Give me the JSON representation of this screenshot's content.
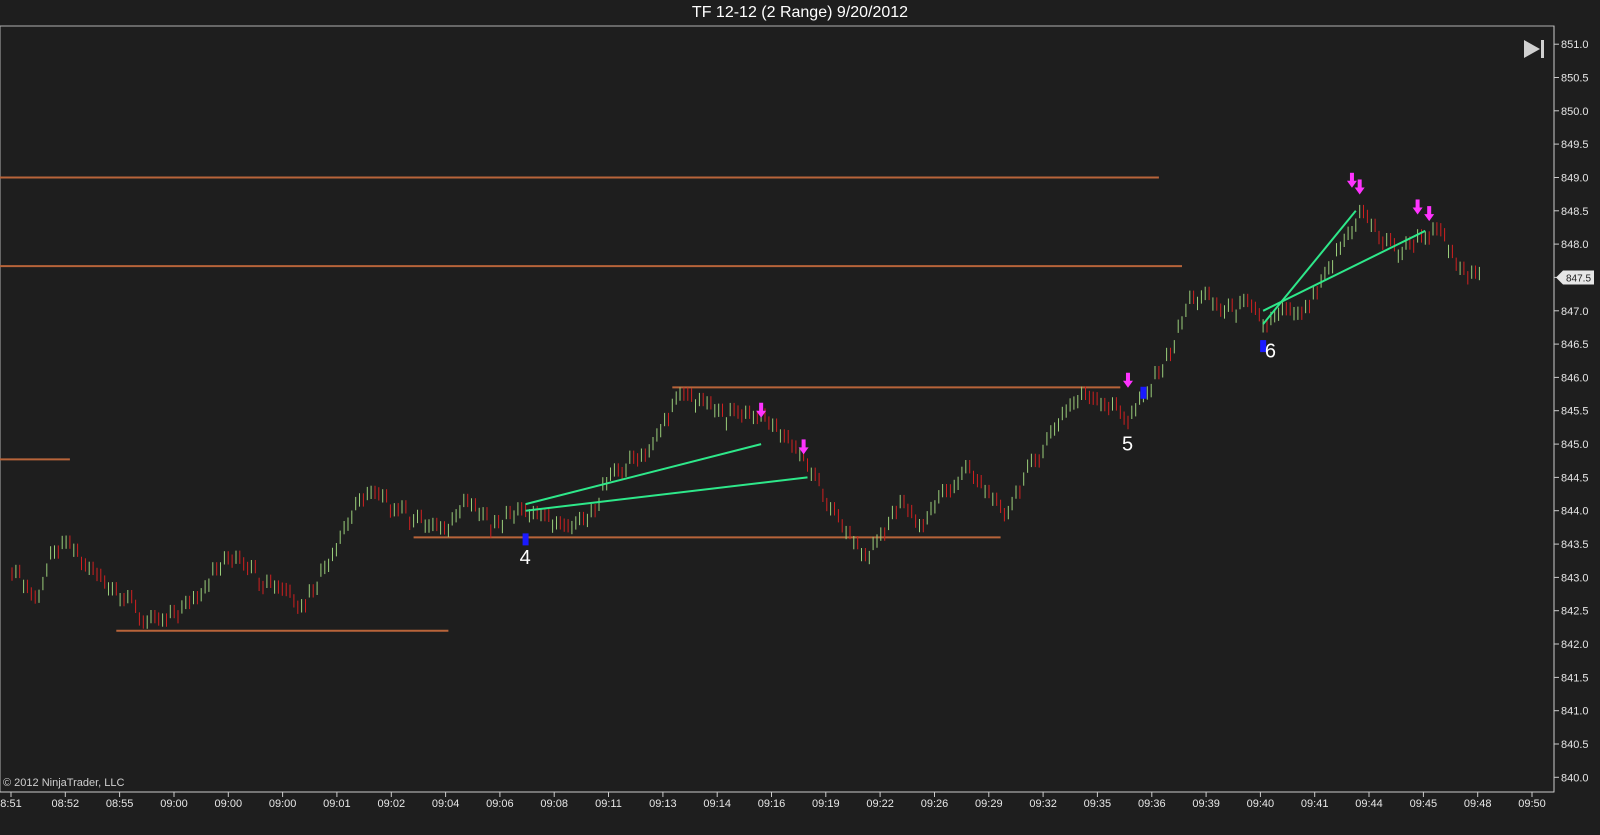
{
  "window": {
    "title": "TF 12-12 (2 Range)  9/20/2012"
  },
  "copyright": "© 2012 NinjaTrader, LLC",
  "current_price_tag": "847.5",
  "colors": {
    "background": "#1e1e1e",
    "up_bar": "#9acd7a",
    "down_bar": "#d02020",
    "level_line": "#b8643a",
    "trend_line": "#2ee88a",
    "sell_signal": "#ff33ff",
    "buy_signal": "#1a1aff",
    "axis": "#cccccc"
  },
  "icons": {
    "scroll_end": "skip-to-end-icon"
  },
  "chart_data": {
    "type": "bar",
    "title": "TF 12-12 (2 Range)  9/20/2012",
    "instrument": "TF 12-12",
    "bar_type": "2 Range",
    "date": "9/20/2012",
    "x_tick_labels": [
      "8:51",
      "08:52",
      "08:55",
      "09:00",
      "09:00",
      "09:00",
      "09:01",
      "09:02",
      "09:04",
      "09:06",
      "09:08",
      "09:11",
      "09:13",
      "09:14",
      "09:16",
      "09:19",
      "09:22",
      "09:26",
      "09:29",
      "09:32",
      "09:35",
      "09:36",
      "09:39",
      "09:40",
      "09:41",
      "09:44",
      "09:45",
      "09:48",
      "09:50"
    ],
    "y_tick_labels": [
      "851.0",
      "850.5",
      "850.0",
      "849.5",
      "849.0",
      "848.5",
      "848.0",
      "847.5",
      "847.0",
      "846.5",
      "846.0",
      "845.5",
      "845.0",
      "844.5",
      "844.0",
      "843.5",
      "843.0",
      "842.5",
      "842.0",
      "841.5",
      "841.0",
      "840.5",
      "840.0"
    ],
    "ylim": [
      839.9,
      851.1
    ],
    "bar_count": 285,
    "bars": [
      {
        "bar": 0,
        "price": 843.1
      },
      {
        "bar": 6,
        "price": 842.7
      },
      {
        "bar": 10,
        "price": 843.3
      },
      {
        "bar": 14,
        "price": 843.5
      },
      {
        "bar": 18,
        "price": 843.2
      },
      {
        "bar": 23,
        "price": 843.0
      },
      {
        "bar": 28,
        "price": 842.8
      },
      {
        "bar": 33,
        "price": 842.4
      },
      {
        "bar": 38,
        "price": 842.3
      },
      {
        "bar": 45,
        "price": 842.6
      },
      {
        "bar": 52,
        "price": 843.1
      },
      {
        "bar": 58,
        "price": 843.4
      },
      {
        "bar": 64,
        "price": 843.0
      },
      {
        "bar": 70,
        "price": 842.9
      },
      {
        "bar": 75,
        "price": 842.6
      },
      {
        "bar": 80,
        "price": 843.1
      },
      {
        "bar": 86,
        "price": 843.8
      },
      {
        "bar": 92,
        "price": 844.3
      },
      {
        "bar": 98,
        "price": 844.1
      },
      {
        "bar": 104,
        "price": 843.9
      },
      {
        "bar": 110,
        "price": 843.7
      },
      {
        "bar": 117,
        "price": 844.1
      },
      {
        "bar": 124,
        "price": 843.8
      },
      {
        "bar": 131,
        "price": 844.0
      },
      {
        "bar": 138,
        "price": 843.9
      },
      {
        "bar": 144,
        "price": 843.7
      },
      {
        "bar": 150,
        "price": 843.95
      },
      {
        "bar": 153,
        "price": 844.4
      },
      {
        "bar": 157,
        "price": 844.6
      },
      {
        "bar": 161,
        "price": 844.8
      },
      {
        "bar": 166,
        "price": 845.0
      },
      {
        "bar": 170,
        "price": 845.5
      },
      {
        "bar": 174,
        "price": 845.8
      },
      {
        "bar": 178,
        "price": 845.6
      },
      {
        "bar": 184,
        "price": 845.45
      },
      {
        "bar": 190,
        "price": 845.5
      },
      {
        "bar": 196,
        "price": 845.3
      },
      {
        "bar": 201,
        "price": 845.1
      },
      {
        "bar": 205,
        "price": 844.7
      },
      {
        "bar": 210,
        "price": 844.2
      },
      {
        "bar": 216,
        "price": 843.6
      },
      {
        "bar": 221,
        "price": 843.3
      },
      {
        "bar": 225,
        "price": 843.7
      },
      {
        "bar": 230,
        "price": 844.1
      },
      {
        "bar": 235,
        "price": 843.8
      },
      {
        "bar": 241,
        "price": 844.3
      },
      {
        "bar": 247,
        "price": 844.6
      },
      {
        "bar": 252,
        "price": 844.3
      },
      {
        "bar": 256,
        "price": 843.9
      },
      {
        "bar": 261,
        "price": 844.4
      },
      {
        "bar": 267,
        "price": 845.0
      },
      {
        "bar": 273,
        "price": 845.6
      },
      {
        "bar": 279,
        "price": 845.8
      },
      {
        "bar": 284,
        "price": 845.6
      },
      {
        "bar": 289,
        "price": 845.4
      },
      {
        "bar": 294,
        "price": 845.8
      },
      {
        "bar": 300,
        "price": 846.4
      },
      {
        "bar": 305,
        "price": 847.2
      },
      {
        "bar": 309,
        "price": 847.2
      },
      {
        "bar": 314,
        "price": 847.0
      },
      {
        "bar": 319,
        "price": 847.1
      },
      {
        "bar": 324,
        "price": 846.8
      },
      {
        "bar": 329,
        "price": 847.0
      },
      {
        "bar": 334,
        "price": 846.9
      },
      {
        "bar": 339,
        "price": 847.4
      },
      {
        "bar": 344,
        "price": 848.0
      },
      {
        "bar": 349,
        "price": 848.5
      },
      {
        "bar": 354,
        "price": 848.1
      },
      {
        "bar": 359,
        "price": 847.9
      },
      {
        "bar": 364,
        "price": 848.1
      },
      {
        "bar": 369,
        "price": 848.2
      },
      {
        "bar": 374,
        "price": 847.6
      },
      {
        "bar": 380,
        "price": 847.5
      }
    ],
    "horizontal_levels": [
      {
        "price": 849.0,
        "from_bar": 0,
        "to_bar": 297
      },
      {
        "price": 847.67,
        "from_bar": 0,
        "to_bar": 303
      },
      {
        "price": 844.77,
        "from_bar": 0,
        "to_bar": 15
      },
      {
        "price": 842.2,
        "from_bar": 27,
        "to_bar": 113
      },
      {
        "price": 843.6,
        "from_bar": 104,
        "to_bar": 256
      },
      {
        "price": 845.85,
        "from_bar": 171,
        "to_bar": 287
      }
    ],
    "trend_lines": [
      {
        "from": [
          133,
          844.1
        ],
        "to": [
          194,
          845.0
        ]
      },
      {
        "from": [
          133,
          844.0
        ],
        "to": [
          206,
          844.5
        ]
      },
      {
        "from": [
          324,
          846.8
        ],
        "to": [
          348,
          848.5
        ]
      },
      {
        "from": [
          324,
          847.0
        ],
        "to": [
          366,
          848.2
        ]
      }
    ],
    "signals": [
      {
        "bar": 133,
        "price": 843.6,
        "type": "buy"
      },
      {
        "bar": 194,
        "price": 845.35,
        "type": "sell"
      },
      {
        "bar": 205,
        "price": 844.8,
        "type": "sell"
      },
      {
        "bar": 289,
        "price": 845.8,
        "type": "sell"
      },
      {
        "bar": 293,
        "price": 845.8,
        "type": "buy"
      },
      {
        "bar": 324,
        "price": 846.5,
        "type": "buy"
      },
      {
        "bar": 347,
        "price": 848.8,
        "type": "sell"
      },
      {
        "bar": 349,
        "price": 848.7,
        "type": "sell"
      },
      {
        "bar": 364,
        "price": 848.4,
        "type": "sell"
      },
      {
        "bar": 367,
        "price": 848.3,
        "type": "sell"
      }
    ],
    "annotations": [
      {
        "text": "4",
        "bar": 133,
        "price": 843.2
      },
      {
        "text": "5",
        "bar": 289,
        "price": 844.9
      },
      {
        "text": "6",
        "bar": 326,
        "price": 846.3
      }
    ],
    "grid": false,
    "legend": "none"
  }
}
